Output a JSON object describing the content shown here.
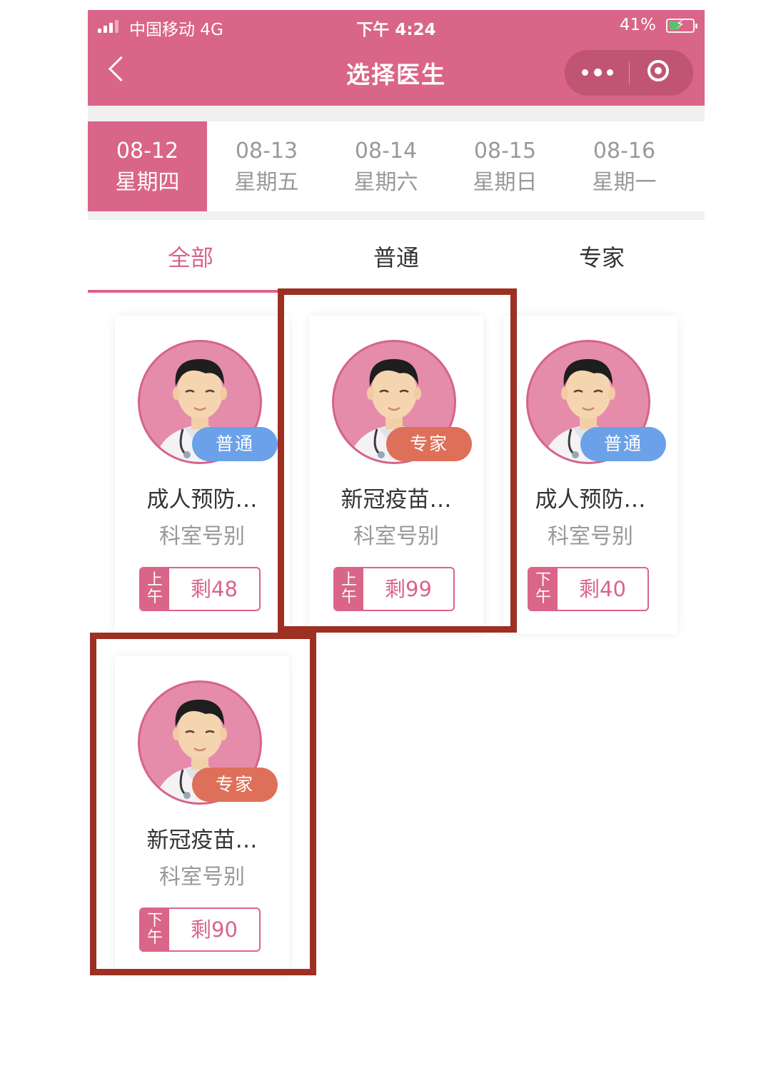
{
  "status_bar": {
    "carrier": "中国移动  4G",
    "time": "下午 4:24",
    "battery": "41%"
  },
  "nav": {
    "title": "选择医生"
  },
  "dates": [
    {
      "date": "08-12",
      "weekday": "星期四"
    },
    {
      "date": "08-13",
      "weekday": "星期五"
    },
    {
      "date": "08-14",
      "weekday": "星期六"
    },
    {
      "date": "08-15",
      "weekday": "星期日"
    },
    {
      "date": "08-16",
      "weekday": "星期一"
    }
  ],
  "tabs": [
    "全部",
    "普通",
    "专家"
  ],
  "doctors": [
    {
      "name": "成人预防…",
      "dept": "科室号别",
      "badge": "普通",
      "period_top": "上",
      "period_bottom": "午",
      "remaining": "剩48"
    },
    {
      "name": "新冠疫苗…",
      "dept": "科室号别",
      "badge": "专家",
      "period_top": "上",
      "period_bottom": "午",
      "remaining": "剩99"
    },
    {
      "name": "成人预防…",
      "dept": "科室号别",
      "badge": "普通",
      "period_top": "下",
      "period_bottom": "午",
      "remaining": "剩40"
    },
    {
      "name": "新冠疫苗…",
      "dept": "科室号别",
      "badge": "专家",
      "period_top": "下",
      "period_bottom": "午",
      "remaining": "剩90"
    }
  ],
  "colors": {
    "primary": "#d96588",
    "badge_normal": "#6ba1e8",
    "badge_expert": "#de7059",
    "highlight_box": "#9c3022"
  }
}
